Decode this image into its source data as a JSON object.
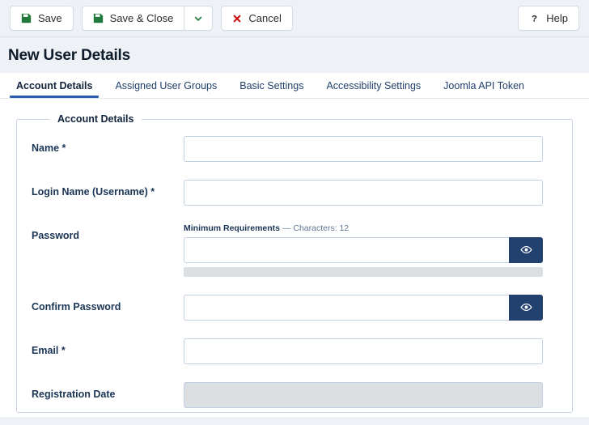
{
  "toolbar": {
    "save_label": "Save",
    "save_close_label": "Save & Close",
    "save_dropdown_label": "",
    "cancel_label": "Cancel",
    "help_label": "Help",
    "icons": {
      "save": "floppy-disk-icon",
      "save_close": "floppy-disk-icon",
      "caret": "chevron-down-icon",
      "cancel": "x-mark-icon",
      "help": "question-mark-icon"
    },
    "colors": {
      "save_icon": "#217a3b",
      "cancel_icon": "#cc0a0a",
      "caret_icon": "#217a3b",
      "help_icon": "#1a1a1a"
    }
  },
  "header": {
    "title": "New User Details"
  },
  "tabs": [
    {
      "label": "Account Details",
      "active": true
    },
    {
      "label": "Assigned User Groups",
      "active": false
    },
    {
      "label": "Basic Settings",
      "active": false
    },
    {
      "label": "Accessibility Settings",
      "active": false
    },
    {
      "label": "Joomla API Token",
      "active": false
    }
  ],
  "fieldset": {
    "legend": "Account Details"
  },
  "fields": {
    "name": {
      "label": "Name *",
      "value": "",
      "placeholder": ""
    },
    "login": {
      "label": "Login Name (Username) *",
      "value": "",
      "placeholder": ""
    },
    "password": {
      "label": "Password",
      "value": "",
      "placeholder": "",
      "hint_strong": "Minimum Requirements",
      "hint_rest": " — Characters: 12",
      "strength_percent": 0,
      "toggle_icon": "eye-icon"
    },
    "confirm_password": {
      "label": "Confirm Password",
      "value": "",
      "placeholder": "",
      "toggle_icon": "eye-icon"
    },
    "email": {
      "label": "Email *",
      "value": "",
      "placeholder": ""
    },
    "registration_date": {
      "label": "Registration Date",
      "value": "",
      "placeholder": "",
      "disabled": true
    }
  },
  "colors": {
    "accent": "#2a5db0",
    "page_bg": "#eef1f6",
    "card_bg": "#ffffff",
    "dark_navy": "#23416e",
    "disabled_bg": "#dcdfe2"
  }
}
